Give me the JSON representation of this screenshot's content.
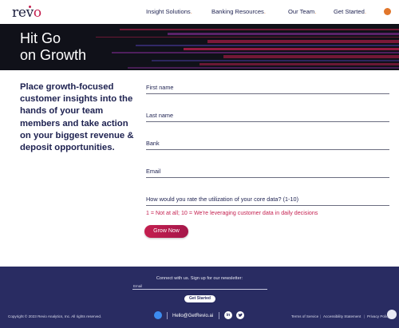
{
  "header": {
    "logo": {
      "text_before": "rev",
      "text_o": "o",
      "dot_letter": "i"
    },
    "nav": [
      {
        "label": "Insight Solutions",
        "dot": "."
      },
      {
        "label": "Banking Resources",
        "dot": "."
      },
      {
        "label": "Our Team",
        "dot": "."
      },
      {
        "label": "Get Started",
        "dot": "."
      }
    ],
    "corner_icon": "brand-badge-icon"
  },
  "hero": {
    "title_line1": "Hit Go",
    "title_line2": "on Growth",
    "background": "#101119",
    "stripe_colors": [
      "#c41f4f",
      "#7a2a8c",
      "#3b2f7a"
    ]
  },
  "main": {
    "intro": "Place growth-focused customer insights into the hands of your team members and take action on your biggest revenue & deposit opportunities.",
    "form": {
      "first_name_label": "First name",
      "last_name_label": "Last name",
      "bank_label": "Bank",
      "email_label": "Email",
      "rating_label": "How would you rate the utilization of your core data? (1-10)",
      "rating_hint": "1 = Not at all; 10 = We're leveraging customer data in daily decisions",
      "submit_label": "Grow Now"
    }
  },
  "footer": {
    "connect_text": "Connect with us. Sign up for our newsletter:",
    "email_label": "Email",
    "started_label": "Get Started",
    "copyright": "Copyright © 2023 Revio Analytics, Inc. All rights reserved.",
    "contact_email": "Hello@GetRevio.ai",
    "linkedin_glyph": "in",
    "twitter_glyph": "🐦",
    "terms": "Terms of Service",
    "accessibility": "Accessibility Statement",
    "privacy": "Privacy Policy",
    "legal_separator": "|"
  },
  "colors": {
    "navy": "#1d2150",
    "footer_bg": "#292c62",
    "accent_red": "#c41f4f",
    "accent_orange": "#e1762b"
  }
}
